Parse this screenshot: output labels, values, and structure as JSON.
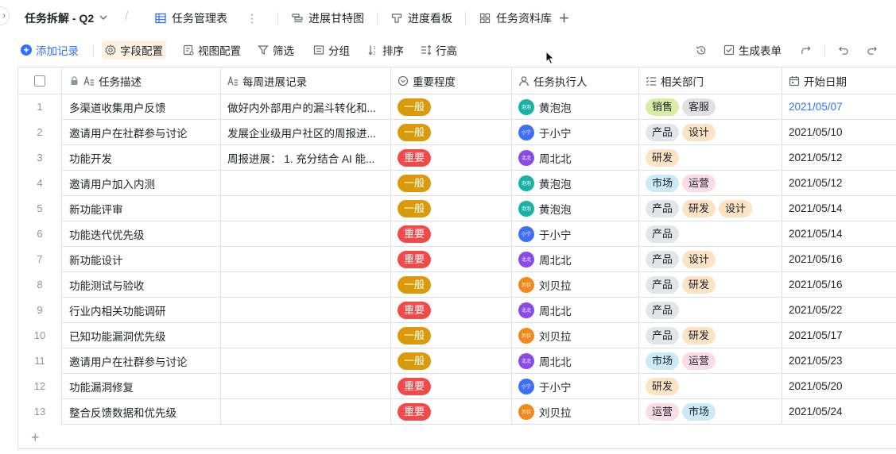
{
  "app": {
    "base_title": "任务拆解 - Q2"
  },
  "tabs": [
    {
      "label": "任务管理表",
      "icon": "grid-table-icon",
      "active": true
    },
    {
      "label": "进展甘特图",
      "icon": "gantt-icon"
    },
    {
      "label": "进度看板",
      "icon": "kanban-icon"
    },
    {
      "label": "任务资料库",
      "icon": "gallery-icon"
    }
  ],
  "toolbar": {
    "add_record": "添加记录",
    "field_config": "字段配置",
    "view_config": "视图配置",
    "filter": "筛选",
    "group": "分组",
    "sort": "排序",
    "row_height": "行高",
    "generate_form": "生成表单"
  },
  "columns": [
    {
      "label": "任务描述",
      "icon": "text-lock-icon"
    },
    {
      "label": "每周进展记录",
      "icon": "text-icon"
    },
    {
      "label": "重要程度",
      "icon": "single-select-icon"
    },
    {
      "label": "任务执行人",
      "icon": "person-icon"
    },
    {
      "label": "相关部门",
      "icon": "multi-select-icon"
    },
    {
      "label": "开始日期",
      "icon": "calendar-icon"
    }
  ],
  "colors": {
    "accent": "#3370ff",
    "prio_normal": "#d99a0b",
    "prio_important": "#f04a4a"
  },
  "tag_colors": {
    "销售": "#d7eea4",
    "客服": "#e0e1e3",
    "产品": "#e2e5ea",
    "设计": "#fbe3c4",
    "研发": "#fbe3c4",
    "市场": "#cbeaf5",
    "运营": "#fadce6"
  },
  "people": {
    "黄泡泡": {
      "color": "#16b3a5",
      "short": "泡泡"
    },
    "于小宁": {
      "color": "#3e6ff5",
      "short": "小宁"
    },
    "周北北": {
      "color": "#8a4ae6",
      "short": "北北"
    },
    "刘贝拉": {
      "color": "#f08b1b",
      "short": "贝拉"
    }
  },
  "rows": [
    {
      "idx": "1",
      "desc": "多渠道收集用户反馈",
      "progress": "做好内外部用户的漏斗转化和...",
      "prio": "一般",
      "person": "黄泡泡",
      "depts": [
        "销售",
        "客服"
      ],
      "date": "2021/05/07",
      "date_link": true
    },
    {
      "idx": "2",
      "desc": "邀请用户在社群参与讨论",
      "progress": "发展企业级用户社区的周报进...",
      "prio": "一般",
      "person": "于小宁",
      "depts": [
        "产品",
        "设计"
      ],
      "date": "2021/05/10"
    },
    {
      "idx": "3",
      "desc": "功能开发",
      "progress": "周报进展： 1. 充分结合 AI 能...",
      "prio": "重要",
      "person": "周北北",
      "depts": [
        "研发"
      ],
      "date": "2021/05/12"
    },
    {
      "idx": "4",
      "desc": "邀请用户加入内测",
      "progress": "",
      "prio": "一般",
      "person": "黄泡泡",
      "depts": [
        "市场",
        "运营"
      ],
      "date": "2021/05/12"
    },
    {
      "idx": "5",
      "desc": "新功能评审",
      "progress": "",
      "prio": "一般",
      "person": "黄泡泡",
      "depts": [
        "产品",
        "研发",
        "设计"
      ],
      "date": "2021/05/14"
    },
    {
      "idx": "6",
      "desc": "功能迭代优先级",
      "progress": "",
      "prio": "重要",
      "person": "于小宁",
      "depts": [
        "产品"
      ],
      "date": "2021/05/14"
    },
    {
      "idx": "7",
      "desc": "新功能设计",
      "progress": "",
      "prio": "重要",
      "person": "周北北",
      "depts": [
        "产品",
        "设计"
      ],
      "date": "2021/05/16"
    },
    {
      "idx": "8",
      "desc": "功能测试与验收",
      "progress": "",
      "prio": "一般",
      "person": "刘贝拉",
      "depts": [
        "产品",
        "研发"
      ],
      "date": "2021/05/16"
    },
    {
      "idx": "9",
      "desc": "行业内相关功能调研",
      "progress": "",
      "prio": "重要",
      "person": "周北北",
      "depts": [
        "产品"
      ],
      "date": "2021/05/22"
    },
    {
      "idx": "10",
      "desc": "已知功能漏洞优先级",
      "progress": "",
      "prio": "一般",
      "person": "刘贝拉",
      "depts": [
        "产品",
        "研发"
      ],
      "date": "2021/05/17"
    },
    {
      "idx": "11",
      "desc": "邀请用户在社群参与讨论",
      "progress": "",
      "prio": "一般",
      "person": "周北北",
      "depts": [
        "市场",
        "运营"
      ],
      "date": "2021/05/23"
    },
    {
      "idx": "12",
      "desc": "功能漏洞修复",
      "progress": "",
      "prio": "重要",
      "person": "于小宁",
      "depts": [
        "研发"
      ],
      "date": "2021/05/20"
    },
    {
      "idx": "13",
      "desc": "整合反馈数据和优先级",
      "progress": "",
      "prio": "重要",
      "person": "刘贝拉",
      "depts": [
        "运营",
        "市场"
      ],
      "date": "2021/05/24"
    }
  ]
}
